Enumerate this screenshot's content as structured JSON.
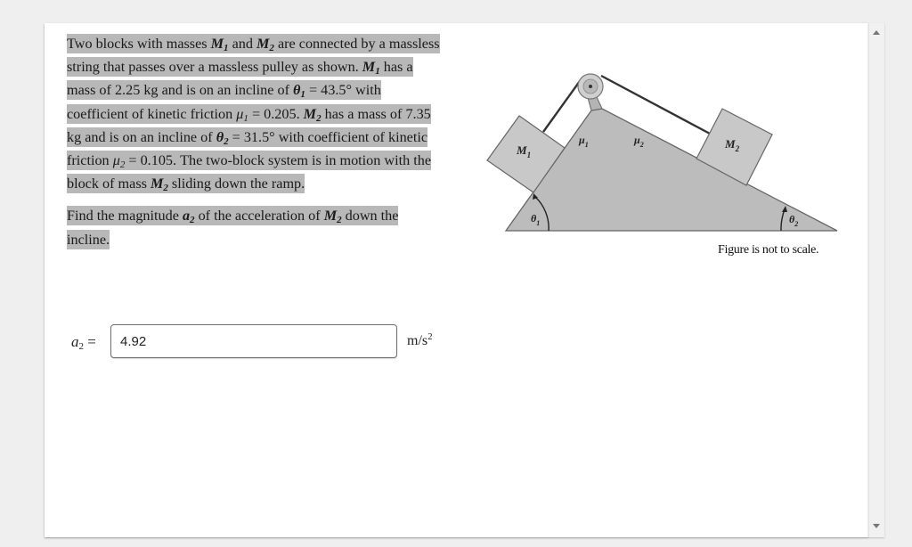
{
  "problem": {
    "para1": {
      "t1": "Two blocks with masses ",
      "m1": "M",
      "m1_sub": "1",
      "t2": " and ",
      "m2": "M",
      "m2_sub": "2",
      "t3": " are connected by a massless string that passes over a massless pulley as shown. ",
      "m1b": "M",
      "m1b_sub": "1",
      "t4": " has a mass of ",
      "mass1": "2.25 kg",
      "t5": " and is on an incline of ",
      "theta1": "θ",
      "theta1_sub": "1",
      "eq1": " = ",
      "theta1_val": "43.5°",
      "t6": " with coefficient of kinetic friction ",
      "mu1": "μ",
      "mu1_sub": "1",
      "eq2": " = ",
      "mu1_val": "0.205",
      "t7": ". ",
      "m2b": "M",
      "m2b_sub": "2",
      "t8": " has a mass of ",
      "mass2": "7.35 kg",
      "t9": " and is on an incline of ",
      "theta2": "θ",
      "theta2_sub": "2",
      "eq3": " = ",
      "theta2_val": "31.5°",
      "t10": " with coefficient of kinetic friction ",
      "mu2": "μ",
      "mu2_sub": "2",
      "eq4": " = ",
      "mu2_val": "0.105",
      "t11": ". The two-block system is in motion with the block of mass ",
      "m2c": "M",
      "m2c_sub": "2",
      "t12": " sliding down the ramp."
    },
    "para2": {
      "t1": "Find the magnitude ",
      "a2": "a",
      "a2_sub": "2",
      "t2": " of the acceleration of ",
      "m2": "M",
      "m2_sub": "2",
      "t3": " down the incline."
    }
  },
  "figure": {
    "block1_label": "M",
    "block1_sub": "1",
    "block2_label": "M",
    "block2_sub": "2",
    "mu1_label": "μ",
    "mu1_sub": "1",
    "mu2_label": "μ",
    "mu2_sub": "2",
    "theta1_label": "θ",
    "theta1_sub": "1",
    "theta2_label": "θ",
    "theta2_sub": "2",
    "caption": "Figure is not to scale.",
    "colors": {
      "ramp": "#bcbcbc",
      "block": "#c8c8c8",
      "outline": "#555555",
      "string": "#333333"
    }
  },
  "answer": {
    "label_var": "a",
    "label_sub": "2",
    "label_eq": " =",
    "value": "4.92",
    "unit": "m/s",
    "unit_sup": "2"
  }
}
